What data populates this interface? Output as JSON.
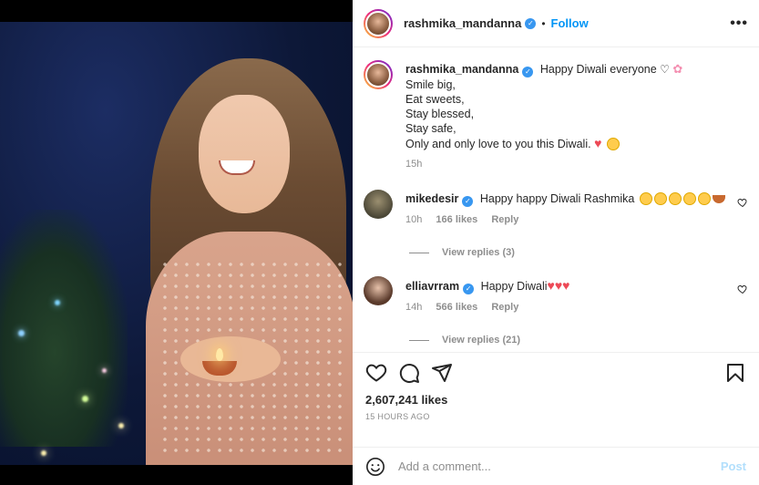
{
  "post": {
    "author": "rashmika_mandanna",
    "follow_label": "Follow",
    "more_label": "•••"
  },
  "caption": {
    "username": "rashmika_mandanna",
    "first_line": "Happy Diwali everyone",
    "lines": [
      "Smile big,",
      "Eat sweets,",
      "Stay blessed,",
      "Stay safe,",
      "Only and only love to you this Diwali."
    ],
    "time": "15h"
  },
  "comments": [
    {
      "username": "mikedesir",
      "text": "Happy happy Diwali Rashmika",
      "time": "10h",
      "likes": "166 likes",
      "reply_label": "Reply",
      "view_replies": "View replies (3)"
    },
    {
      "username": "elliavrram",
      "text": "Happy Diwali",
      "time": "14h",
      "likes": "566 likes",
      "reply_label": "Reply",
      "view_replies": "View replies (21)"
    }
  ],
  "stats": {
    "likes": "2,607,241 likes",
    "posted": "15 HOURS AGO"
  },
  "composer": {
    "placeholder": "Add a comment...",
    "post_label": "Post"
  },
  "icons": {
    "header": [
      "verified-badge-icon",
      "more-options-icon"
    ],
    "actions": [
      "heart-icon",
      "comment-icon",
      "share-icon",
      "bookmark-icon"
    ],
    "composer": [
      "emoji-icon"
    ]
  },
  "colors": {
    "accent": "#0095f6",
    "verified": "#3897f0",
    "muted": "#8e8e8e",
    "heart": "#ed4956"
  }
}
